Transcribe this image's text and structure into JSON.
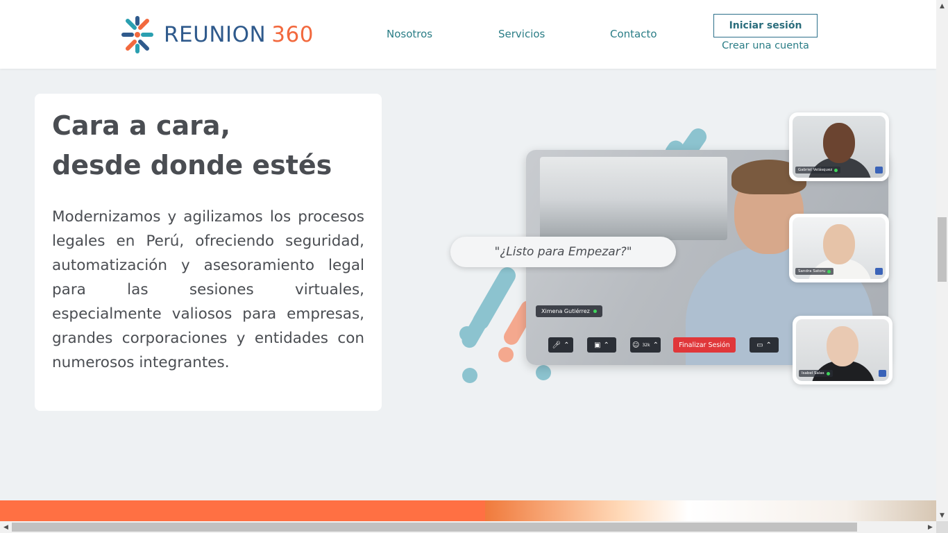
{
  "brand": {
    "logo_word": "REUNION",
    "logo_number": "360"
  },
  "nav": {
    "links": [
      "Nosotros",
      "Servicios",
      "Contacto"
    ],
    "login_label": "Iniciar sesión",
    "signup_label": "Crear una cuenta"
  },
  "hero": {
    "title_line1": "Cara a cara,",
    "title_line2": "desde donde estés",
    "body": "Modernizamos y agilizamos los procesos legales en Perú, ofreciendo seguridad, automatización y asesoramiento legal para las sesiones virtuales, especialmente valiosos para empresas, grandes corporaciones y entidades con numerosos integrantes."
  },
  "illustration": {
    "bubble_text": "\"¿Listo para Empezar?\"",
    "main_participant": "Ximena Gutiérrez",
    "end_call_label": "Finalizar Sesión",
    "participants_count": "32k",
    "thumbnails": [
      "Gabriel Velásquez",
      "Sandra Satoru",
      "Isabel Salas"
    ]
  },
  "colors": {
    "accent_teal": "#2a7d86",
    "brand_blue": "#2f5a8c",
    "brand_orange": "#f2693e",
    "band_orange": "#ff7043",
    "end_call_red": "#e0373a"
  }
}
